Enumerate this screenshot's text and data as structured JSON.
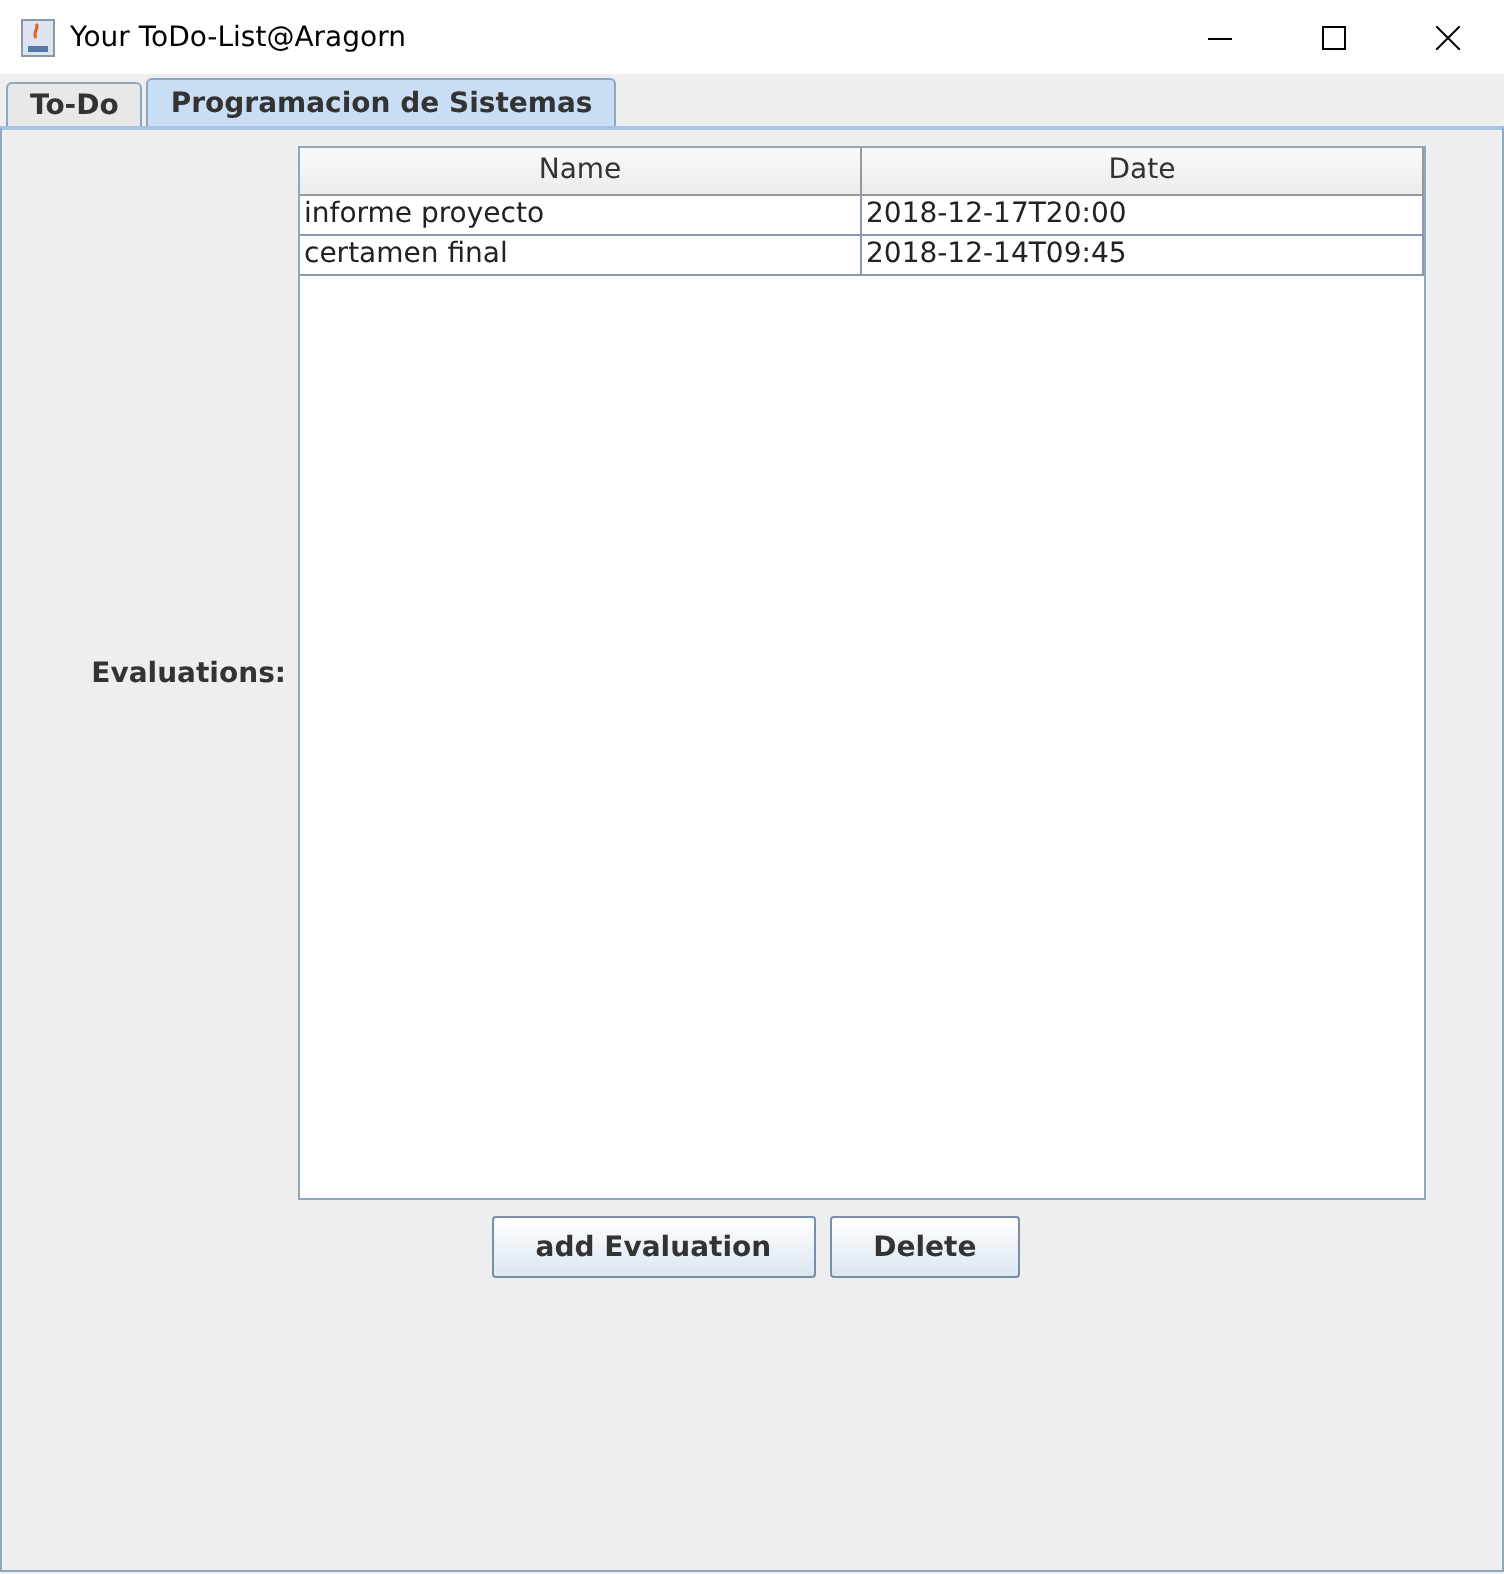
{
  "window": {
    "title": "Your ToDo-List@Aragorn"
  },
  "tabs": [
    {
      "label": "To-Do",
      "selected": false
    },
    {
      "label": "Programacion de Sistemas",
      "selected": true
    }
  ],
  "evaluations": {
    "label": "Evaluations:",
    "columns": [
      "Name",
      "Date"
    ],
    "rows": [
      [
        "informe proyecto",
        "2018-12-17T20:00"
      ],
      [
        "certamen final",
        "2018-12-14T09:45"
      ]
    ]
  },
  "buttons": [
    "add Evaluation",
    "Delete"
  ]
}
